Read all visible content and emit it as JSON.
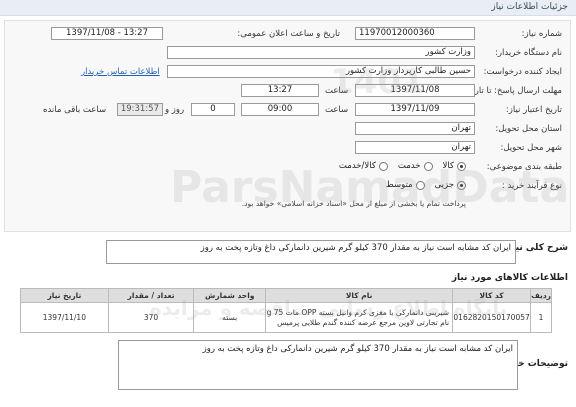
{
  "header": {
    "title": "جزئیات اطلاعات نیاز"
  },
  "form": {
    "need_number": {
      "label": "شماره نیاز:",
      "value": "11970012000360"
    },
    "announce": {
      "label": "تاریخ و ساعت اعلان عمومی:",
      "value": "1397/11/08 - 13:27"
    },
    "buyer_org": {
      "label": "نام دستگاه خریدار:",
      "value": "وزارت کشور"
    },
    "requester": {
      "label": "ایجاد کننده درخواست:",
      "value": "حسین طالبی کارپرداز وزارت کشور"
    },
    "contact_link": "اطلاعات تماس خریدار",
    "send_deadline": {
      "label": "مهلت ارسال پاسخ: تا تاریخ:",
      "date": "1397/11/08",
      "time_label": "ساعت",
      "time": "13:27"
    },
    "validity": {
      "label": "تاریخ اعتبار نیاز:",
      "date": "1397/11/09",
      "time_label": "ساعت",
      "time": "09:00"
    },
    "remaining": {
      "days": "0",
      "days_label": "روز و",
      "clock": "19:31:57",
      "clock_label": "ساعت باقی مانده"
    },
    "province": {
      "label": "استان محل تحویل:",
      "value": "تهران"
    },
    "city": {
      "label": "شهر محل تحویل:",
      "value": "تهران"
    },
    "category": {
      "label": "طبقه بندی موضوعی:",
      "options": [
        "کالا",
        "خدمت",
        "کالا/خدمت"
      ],
      "selected": 0
    },
    "process": {
      "label": "نوع فرآیند خرید :",
      "options": [
        "جزیی",
        "متوسط"
      ],
      "selected": 0
    },
    "process_note": "پرداخت تمام یا بخشی از مبلغ از محل «اسناد خزانه اسلامی» خواهد بود."
  },
  "general_desc": {
    "label": "شرح کلی نیاز:",
    "value": "ایران کد مشابه است نیاز به مقدار 370 کیلو گرم شیرین دانمارکی داغ وتازه پخت به روز"
  },
  "goods": {
    "title": "اطلاعات کالاهای مورد نیاز",
    "columns": [
      "ردیف",
      "کد کالا",
      "نام کالا",
      "واحد شمارش",
      "تعداد / مقدار",
      "تاریخ نیاز"
    ],
    "rows": [
      {
        "index": "1",
        "code": "0162820150170057",
        "name_line1": "شیرینی دانمارکی با مغزی کرم وانیل بسته OPP مات 75 g",
        "name_line2": "نام تجارتی لاوین مرجع عرضه کننده گندم طلایی پرمیس",
        "unit": "بسته",
        "qty": "370",
        "date": "1397/11/10"
      }
    ]
  },
  "buyer_notes": {
    "label": "توضیحات خریدار:",
    "value": "ایران کد مشابه است نیاز به مقدار 370 کیلو گرم شیرین دانمارکی داغ وتازه پخت به روز"
  },
  "watermarks": [
    "1401",
    "ParsNamadData",
    "پایگاه اطلاع رسانی مناقصه و مزایده"
  ]
}
